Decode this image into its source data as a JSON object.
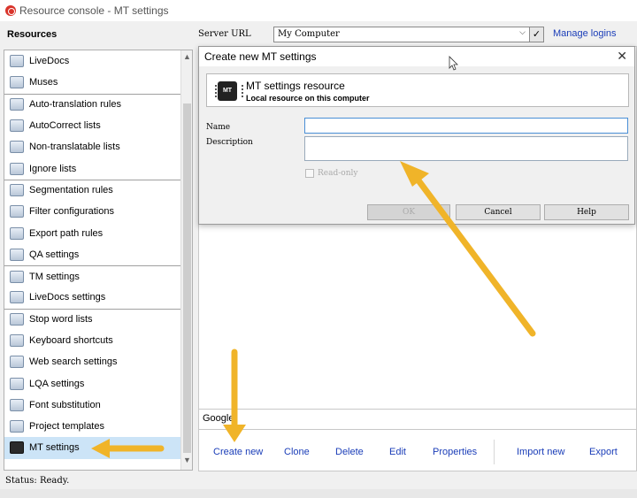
{
  "window": {
    "title": "Resource console - MT settings"
  },
  "header": {
    "resources_label": "Resources",
    "server_url_label": "Server URL",
    "server_url_value": "My Computer",
    "manage_logins": "Manage logins"
  },
  "sidebar": {
    "items": [
      {
        "label": "LiveDocs",
        "icon": "livedocs-icon"
      },
      {
        "label": "Muses",
        "icon": "muses-icon"
      },
      {
        "label": "Auto-translation rules",
        "icon": "auto-translation-rules-icon"
      },
      {
        "label": "AutoCorrect lists",
        "icon": "autocorrect-icon"
      },
      {
        "label": "Non-translatable lists",
        "icon": "non-translatable-icon"
      },
      {
        "label": "Ignore lists",
        "icon": "ignore-lists-icon"
      },
      {
        "label": "Segmentation rules",
        "icon": "segmentation-icon"
      },
      {
        "label": "Filter configurations",
        "icon": "filter-icon"
      },
      {
        "label": "Export path rules",
        "icon": "export-path-icon"
      },
      {
        "label": "QA settings",
        "icon": "qa-icon"
      },
      {
        "label": "TM settings",
        "icon": "tm-settings-icon"
      },
      {
        "label": "LiveDocs settings",
        "icon": "livedocs-settings-icon"
      },
      {
        "label": "Stop word lists",
        "icon": "stop-word-icon"
      },
      {
        "label": "Keyboard shortcuts",
        "icon": "keyboard-icon"
      },
      {
        "label": "Web search settings",
        "icon": "web-search-icon"
      },
      {
        "label": "LQA settings",
        "icon": "lqa-icon"
      },
      {
        "label": "Font substitution",
        "icon": "font-icon"
      },
      {
        "label": "Project templates",
        "icon": "project-templates-icon"
      },
      {
        "label": "MT settings",
        "icon": "mt-settings-icon"
      }
    ],
    "selected": "MT settings"
  },
  "main": {
    "list_item": "Google",
    "actions": [
      "Create new",
      "Clone",
      "Delete",
      "Edit",
      "Properties",
      "Import new",
      "Export"
    ]
  },
  "dialog": {
    "title": "Create new MT settings",
    "header_title": "MT settings resource",
    "header_subtitle": "Local resource on this computer",
    "icon_text": "MT",
    "name_label": "Name",
    "name_value": "",
    "description_label": "Description",
    "description_value": "",
    "readonly_label": "Read-only",
    "ok": "OK",
    "cancel": "Cancel",
    "help": "Help"
  },
  "status": {
    "text": "Status: Ready."
  },
  "colors": {
    "link": "#1a3db8",
    "selection": "#cce4f7",
    "annotation_arrow": "#f0b429"
  }
}
